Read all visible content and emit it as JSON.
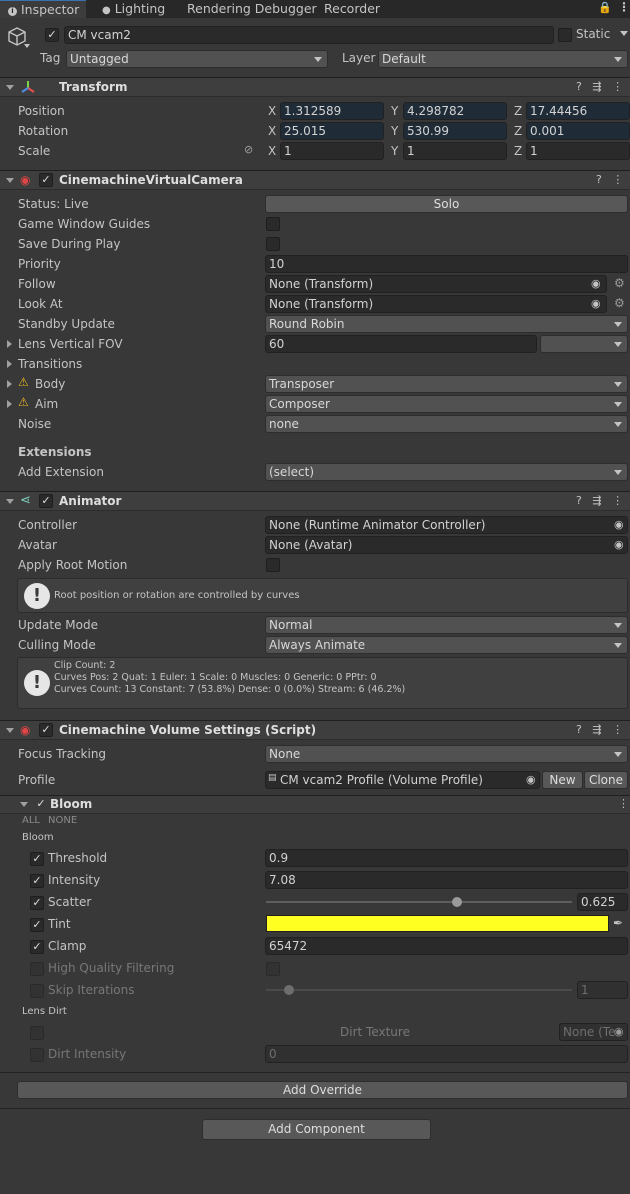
{
  "tabs": [
    {
      "label": "Inspector",
      "icon": "info-icon"
    },
    {
      "label": "Lighting",
      "icon": "lightbulb-icon"
    },
    {
      "label": "Rendering Debugger"
    },
    {
      "label": "Recorder"
    }
  ],
  "gameobject": {
    "name": "CM vcam2",
    "static_label": "Static",
    "tag_label": "Tag",
    "tag_value": "Untagged",
    "layer_label": "Layer",
    "layer_value": "Default"
  },
  "transform": {
    "title": "Transform",
    "rows": [
      {
        "label": "Position",
        "x": "1.312589",
        "y": "4.298782",
        "z": "17.44456"
      },
      {
        "label": "Rotation",
        "x": "25.015",
        "y": "530.99",
        "z": "0.001"
      },
      {
        "label": "Scale",
        "x": "1",
        "y": "1",
        "z": "1"
      }
    ],
    "axis": {
      "x": "X",
      "y": "Y",
      "z": "Z"
    }
  },
  "vcam": {
    "title": "CinemachineVirtualCamera",
    "status_label": "Status: Live",
    "solo_button": "Solo",
    "game_window_guides": "Game Window Guides",
    "save_during_play": "Save During Play",
    "priority_label": "Priority",
    "priority_value": "10",
    "follow_label": "Follow",
    "follow_value": "None (Transform)",
    "lookat_label": "Look At",
    "lookat_value": "None (Transform)",
    "standby_label": "Standby Update",
    "standby_value": "Round Robin",
    "lens_label": "Lens Vertical FOV",
    "lens_value": "60",
    "transitions_label": "Transitions",
    "body_label": "Body",
    "body_value": "Transposer",
    "aim_label": "Aim",
    "aim_value": "Composer",
    "noise_label": "Noise",
    "noise_value": "none",
    "extensions_label": "Extensions",
    "add_extension_label": "Add Extension",
    "add_extension_value": "(select)"
  },
  "animator": {
    "title": "Animator",
    "controller_label": "Controller",
    "controller_value": "None (Runtime Animator Controller)",
    "avatar_label": "Avatar",
    "avatar_value": "None (Avatar)",
    "apply_root_motion": "Apply Root Motion",
    "root_help": "Root position or rotation are controlled by curves",
    "update_mode_label": "Update Mode",
    "update_mode_value": "Normal",
    "culling_mode_label": "Culling Mode",
    "culling_mode_value": "Always Animate",
    "clip_line1": "Clip Count: 2",
    "clip_line2": "Curves Pos: 2 Quat: 1 Euler: 1 Scale: 0 Muscles: 0 Generic: 0 PPtr: 0",
    "clip_line3": "Curves Count: 13 Constant: 7 (53.8%) Dense: 0 (0.0%) Stream: 6 (46.2%)"
  },
  "volume": {
    "title": "Cinemachine Volume Settings (Script)",
    "focus_label": "Focus Tracking",
    "focus_value": "None",
    "profile_label": "Profile",
    "profile_value": "CM vcam2 Profile (Volume Profile)",
    "new_button": "New",
    "clone_button": "Clone"
  },
  "bloom": {
    "title": "Bloom",
    "all": "ALL",
    "none": "NONE",
    "group_label": "Bloom",
    "threshold_label": "Threshold",
    "threshold_value": "0.9",
    "intensity_label": "Intensity",
    "intensity_value": "7.08",
    "scatter_label": "Scatter",
    "scatter_value": "0.625",
    "scatter_fraction": 0.625,
    "tint_label": "Tint",
    "tint_color": "#ffff22",
    "clamp_label": "Clamp",
    "clamp_value": "65472",
    "hq_label": "High Quality Filtering",
    "skip_label": "Skip Iterations",
    "skip_value": "1",
    "lens_dirt_label": "Lens Dirt",
    "dirt_texture_label": "Dirt Texture",
    "dirt_texture_value": "None (Te",
    "dirt_intensity_label": "Dirt Intensity",
    "dirt_intensity_value": "0"
  },
  "add_override": "Add Override",
  "add_component": "Add Component"
}
